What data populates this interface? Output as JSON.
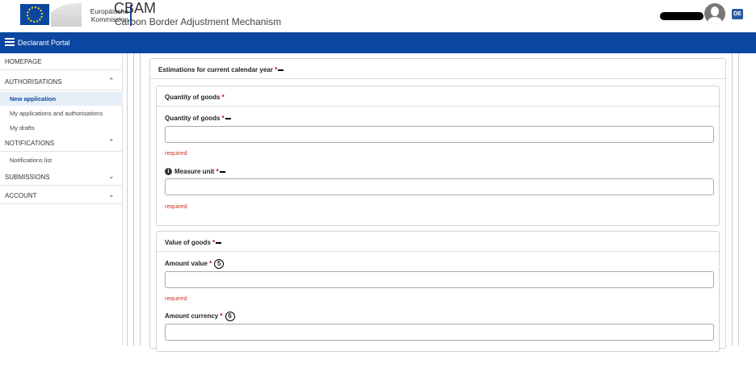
{
  "header": {
    "logo_line1": "Europäische",
    "logo_line2": "Kommission",
    "app_title": "CBAM",
    "app_subtitle": "Carbon Border Adjustment Mechanism",
    "lang_badge": "DE",
    "brand_color": "#0b47a1"
  },
  "topbar": {
    "portal_label": "Declarant Portal"
  },
  "sidebar": {
    "homepage": "HOMEPAGE",
    "authorisations": "AUTHORISATIONS",
    "new_application": "New application",
    "my_applications": "My applications and authorisations",
    "my_drafts": "My drafts",
    "notifications": "NOTIFICATIONS",
    "notifications_list": "Notifications list",
    "submissions": "SUBMISSIONS",
    "account": "ACCOUNT"
  },
  "main": {
    "section_title": "Estimations for current calendar year",
    "quantity_card_title": "Quantity of goods",
    "quantity_label": "Quantity of goods",
    "quantity_value": "",
    "quantity_error": "required",
    "measure_unit_label": "Measure unit",
    "measure_unit_value": "",
    "measure_unit_error": "required",
    "value_card_title": "Value of goods",
    "amount_value_label": "Amount value",
    "amount_value_marker": "5",
    "amount_value_value": "",
    "amount_value_error": "required",
    "amount_currency_label": "Amount currency",
    "amount_currency_marker": "6",
    "amount_currency_value": "",
    "required_star": "*"
  }
}
